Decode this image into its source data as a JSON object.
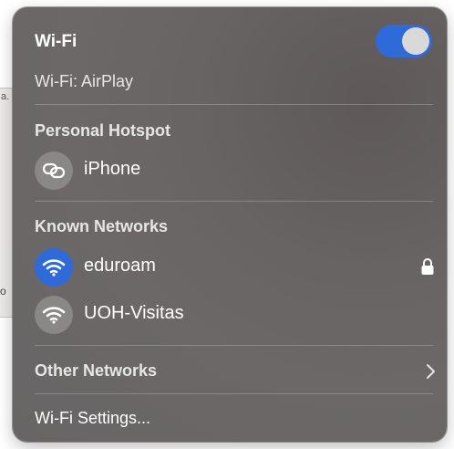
{
  "wifi": {
    "title": "Wi-Fi",
    "enabled": true,
    "airplay_label": "Wi-Fi: AirPlay"
  },
  "hotspot": {
    "section_title": "Personal Hotspot",
    "items": [
      {
        "label": "iPhone",
        "icon": "hotspot-link-icon"
      }
    ]
  },
  "known_networks": {
    "section_title": "Known Networks",
    "items": [
      {
        "label": "eduroam",
        "icon": "wifi-icon",
        "connected": true,
        "secured": true
      },
      {
        "label": "UOH-Visitas",
        "icon": "wifi-icon",
        "connected": false,
        "secured": false
      }
    ]
  },
  "other_networks": {
    "label": "Other Networks",
    "icon": "chevron-right-icon"
  },
  "settings": {
    "label": "Wi-Fi Settings..."
  },
  "background": {
    "text1": "a.",
    "text2": "o"
  },
  "colors": {
    "accent": "#2f6bd8",
    "panel": "#686463",
    "text": "#ffffff"
  }
}
